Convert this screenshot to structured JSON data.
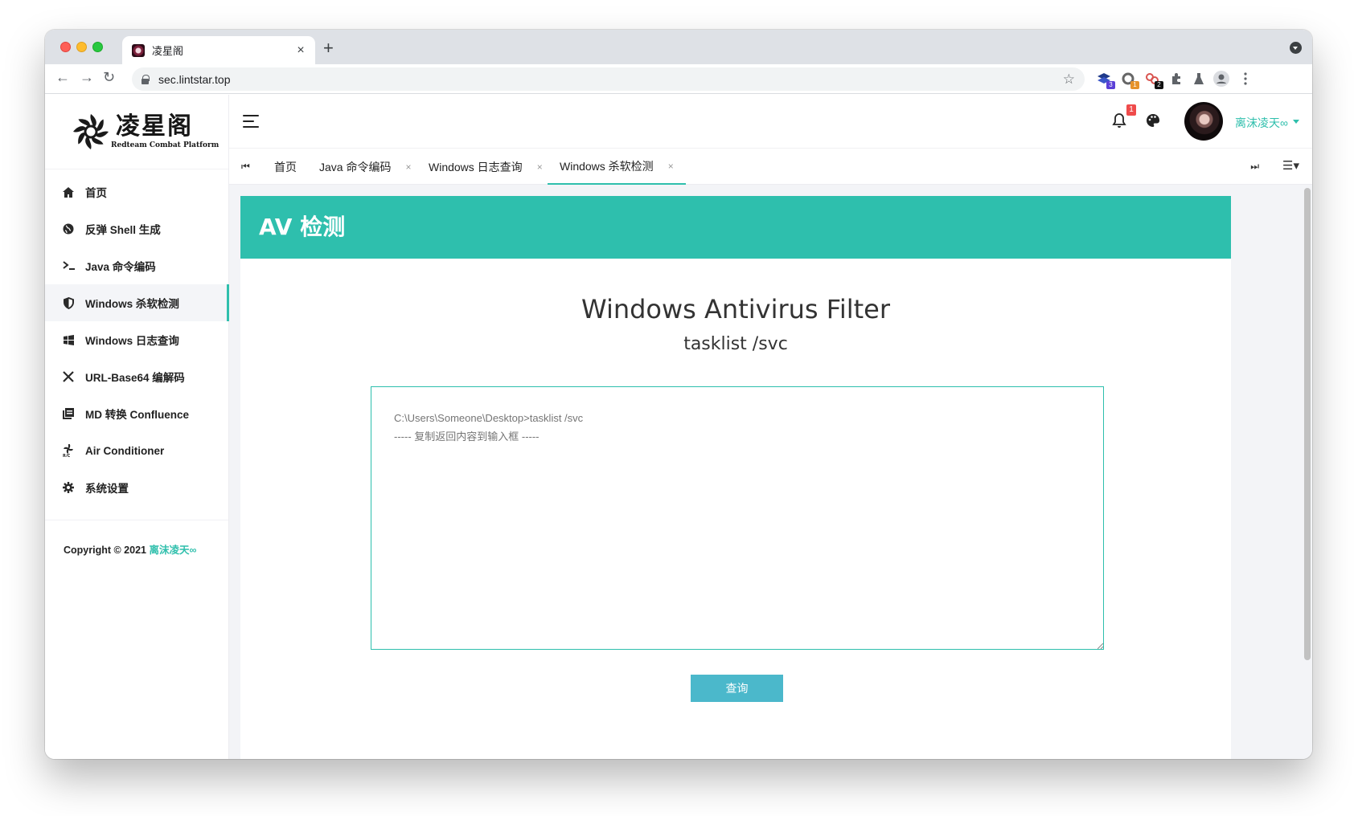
{
  "browser": {
    "tab_title": "凌星阁",
    "tab_close": "×",
    "new_tab": "+",
    "url": "sec.lintstar.top",
    "extensions": [
      {
        "name": "ext-stack",
        "badge": "3",
        "color": "#5b3fd6"
      },
      {
        "name": "ext-ring",
        "badge": "1",
        "color": "#e6932a"
      },
      {
        "name": "ext-chain",
        "badge": "2",
        "color": "#111111"
      }
    ]
  },
  "sidebar": {
    "logo_cn": "凌星阁",
    "logo_en": "Redteam Combat Platform",
    "items": [
      {
        "label": "首页",
        "icon": "home-icon"
      },
      {
        "label": "反弹 Shell 生成",
        "icon": "globe-icon"
      },
      {
        "label": "Java 命令编码",
        "icon": "terminal-icon"
      },
      {
        "label": "Windows 杀软检测",
        "icon": "shield-icon"
      },
      {
        "label": "Windows 日志查询",
        "icon": "windows-icon"
      },
      {
        "label": "URL-Base64 编解码",
        "icon": "tools-icon"
      },
      {
        "label": "MD 转换 Confluence",
        "icon": "book-icon"
      },
      {
        "label": "Air Conditioner",
        "icon": "fan-icon"
      },
      {
        "label": "系统设置",
        "icon": "gear-icon"
      }
    ],
    "active_index": 3,
    "copyright_prefix": "Copyright © 2021",
    "copyright_author": "离沫凌天∞"
  },
  "header": {
    "notification_count": "1",
    "username": "离沫凌天∞"
  },
  "tabs": [
    {
      "label": "首页",
      "closable": false
    },
    {
      "label": "Java 命令编码",
      "closable": true
    },
    {
      "label": "Windows 日志查询",
      "closable": true
    },
    {
      "label": "Windows 杀软检测",
      "closable": true,
      "active": true
    }
  ],
  "tab_close_glyph": "×",
  "card": {
    "header": "AV 检测",
    "title": "Windows Antivirus Filter",
    "subtitle": "tasklist /svc",
    "placeholder": "C:\\Users\\Someone\\Desktop>tasklist /svc\n----- 复制返回内容到输入框 -----",
    "value": "",
    "button": "查询"
  },
  "colors": {
    "accent": "#2ebfad",
    "button": "#4bb8cb",
    "badge": "#ef4b4b"
  }
}
